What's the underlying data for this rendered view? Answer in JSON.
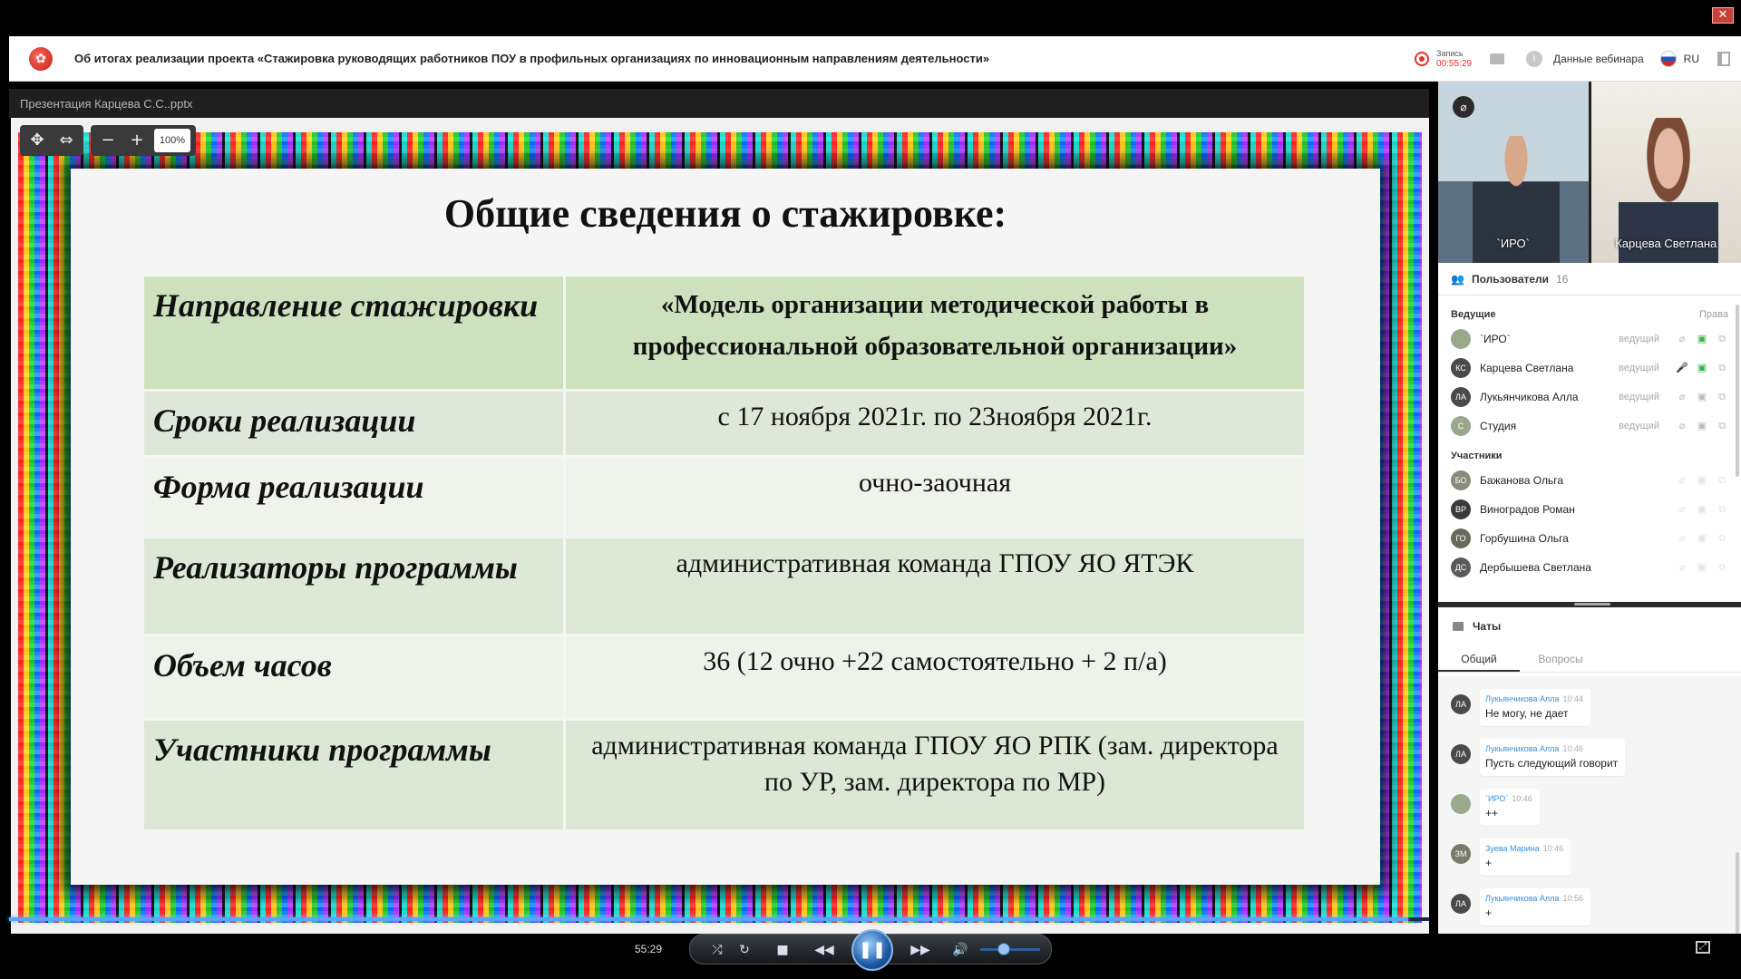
{
  "header": {
    "title": "Об итогах реализации проекта «Стажировка руководящих работников ПОУ в профильных организациях по инновационным направлениям деятельности»",
    "recording_label": "Запись",
    "recording_time": "00:55:29",
    "webinar_data_label": "Данные вебинара",
    "language": "RU",
    "icons": [
      "app-logo-icon",
      "record-icon",
      "folder-icon",
      "info-icon",
      "flag-ru-icon",
      "exit-icon"
    ],
    "colors": {
      "record": "#e6302a",
      "accent": "#3a8fd6"
    }
  },
  "presentation": {
    "file_name": "Презентация Карцева С.С..pptx",
    "zoom_level": "100%",
    "zoom_out": "−",
    "zoom_in": "+",
    "slide": {
      "title": "Общие сведения о стажировке:",
      "rows": [
        {
          "key": "Направление стажировки",
          "value": "«Модель организации методической работы в профессиональной образовательной организации»"
        },
        {
          "key": "Сроки  реализации",
          "value": "с 17 ноября 2021г. по 23ноября 2021г."
        },
        {
          "key": "Форма реализации",
          "value": "очно-заочная"
        },
        {
          "key": "Реализаторы программы",
          "value": "административная команда ГПОУ ЯО ЯТЭК"
        },
        {
          "key": "Объем часов",
          "value": "36 (12 очно +22  самостоятельно + 2 п/а)"
        },
        {
          "key": "Участники программы",
          "value": "административная команда ГПОУ ЯО РПК (зам. директора по УР, зам. директора по МР)"
        }
      ]
    }
  },
  "videos": [
    {
      "name": "`ИРО`",
      "muted": true
    },
    {
      "name": "Карцева Светлана",
      "muted": false
    }
  ],
  "users": {
    "title": "Пользователи",
    "count": "16",
    "hosts_label": "Ведущие",
    "rights_label": "Права",
    "participants_label": "Участники",
    "hosts": [
      {
        "initials": "",
        "name": "`ИРО`",
        "role": "ведущий",
        "color": "#9aa88c"
      },
      {
        "initials": "КС",
        "name": "Карцева Светлана",
        "role": "ведущий",
        "color": "#4a4a4a"
      },
      {
        "initials": "ЛА",
        "name": "Лукьянчикова Алла",
        "role": "ведущий",
        "color": "#4a4a4a"
      },
      {
        "initials": "С",
        "name": "Студия",
        "role": "ведущий",
        "color": "#9aa88c"
      }
    ],
    "participants": [
      {
        "initials": "БО",
        "name": "Бажанова Ольга",
        "color": "#8a8a7a"
      },
      {
        "initials": "ВР",
        "name": "Виноградов Роман",
        "color": "#3a3a3a"
      },
      {
        "initials": "ГО",
        "name": "Горбушина Ольга",
        "color": "#6a6a5a"
      },
      {
        "initials": "ДС",
        "name": "Дербышева Светлана",
        "color": "#5a5a5a"
      }
    ]
  },
  "chat": {
    "title": "Чаты",
    "tabs": [
      "Общий",
      "Вопросы"
    ],
    "messages": [
      {
        "initials": "ЛА",
        "author": "Лукьянчикова Алла",
        "time": "10:44",
        "text": "Не могу, не дает",
        "color": "#4a4a4a"
      },
      {
        "initials": "ЛА",
        "author": "Лукьянчикова Алла",
        "time": "10:46",
        "text": "Пусть следующий говорит",
        "color": "#4a4a4a"
      },
      {
        "initials": "",
        "author": "`ИРО`",
        "time": "10:46",
        "text": "++",
        "color": "#9aa88c"
      },
      {
        "initials": "ЗМ",
        "author": "Зуева Марина",
        "time": "10:46",
        "text": "+",
        "color": "#7a7a6a"
      },
      {
        "initials": "ЛА",
        "author": "Лукьянчикова Алла",
        "time": "10:56",
        "text": "+",
        "color": "#4a4a4a"
      }
    ]
  },
  "player": {
    "time": "55:29",
    "progress": 0.985,
    "volume": 0.4
  }
}
